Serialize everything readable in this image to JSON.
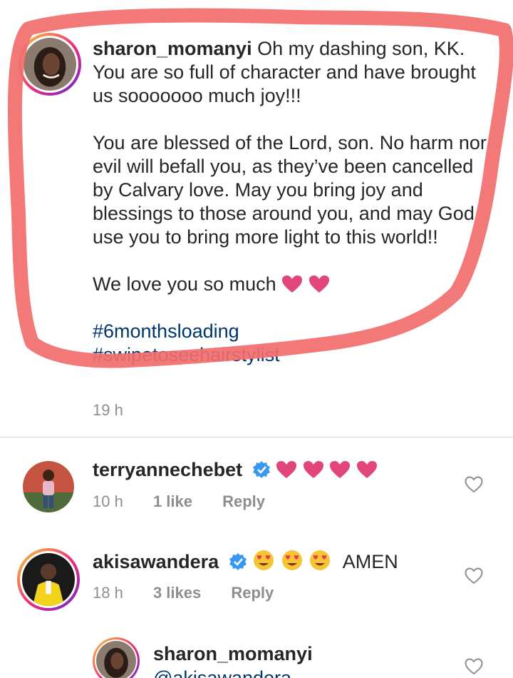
{
  "post": {
    "username": "sharon_momanyi",
    "caption_first": "Oh my dashing son, KK. You are so full of character and have brought us sooooooo much joy!!!",
    "caption_second": "You are blessed of the Lord, son. No harm nor evil will befall you, as they’ve been cancelled by Calvary love. May you bring joy and blessings to those around you, and may God use you to bring more light to this world!!",
    "caption_third": "We love you so much",
    "hashtags": [
      "#6monthsloading",
      "#swipetoseehairstylist"
    ],
    "time": "19 h"
  },
  "comments": [
    {
      "username": "terryannechebet",
      "verified": true,
      "text": "",
      "time": "10 h",
      "likes": "1 like",
      "reply": "Reply"
    },
    {
      "username": "akisawandera",
      "verified": true,
      "text": "AMEN",
      "time": "18 h",
      "likes": "3 likes",
      "reply": "Reply"
    }
  ],
  "reply_comment": {
    "username": "sharon_momanyi",
    "mention": "@akisawandera"
  },
  "colors": {
    "highlight_marker": "#f26d6d",
    "link": "#00376b",
    "muted": "#8e8e8e",
    "heart_emoji": "#e0457b",
    "verified_blue": "#3897f0"
  },
  "icons": [
    "heart-emoji",
    "smiling-heart-eyes-emoji",
    "verified-badge-icon",
    "like-heart-icon"
  ]
}
